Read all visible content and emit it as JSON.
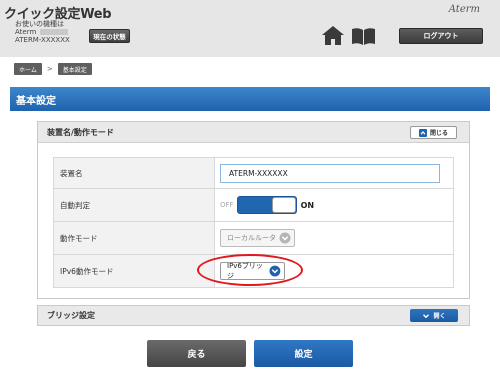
{
  "header": {
    "app_title": "クイック設定Web",
    "model_caption": "お使いの機種は",
    "model_line1": "Aterm",
    "model_line2": "ATERM-XXXXXX",
    "status_button": "現在の状態",
    "brand_logo": "Aterm",
    "logout_button": "ログアウト"
  },
  "breadcrumb": {
    "items": [
      "ホーム",
      "基本設定"
    ],
    "separator": ">"
  },
  "page_title": "基本設定",
  "panel": {
    "title": "装置名/動作モード",
    "close_label": "閉じる",
    "rows": [
      {
        "label": "装置名",
        "value": "ATERM-XXXXXX"
      },
      {
        "label": "自動判定",
        "off": "OFF",
        "on": "ON"
      },
      {
        "label": "動作モード",
        "value": "ローカルルータ"
      },
      {
        "label": "IPv6動作モード",
        "value": "IPv6ブリッジ"
      }
    ]
  },
  "bridge_panel": {
    "title": "ブリッジ設定",
    "open_label": "開く"
  },
  "buttons": {
    "back": "戻る",
    "submit": "設定"
  },
  "colors": {
    "accent_blue": "#1f63ad",
    "highlight_red": "#e3171c",
    "header_bg": "#e6e6e6"
  }
}
